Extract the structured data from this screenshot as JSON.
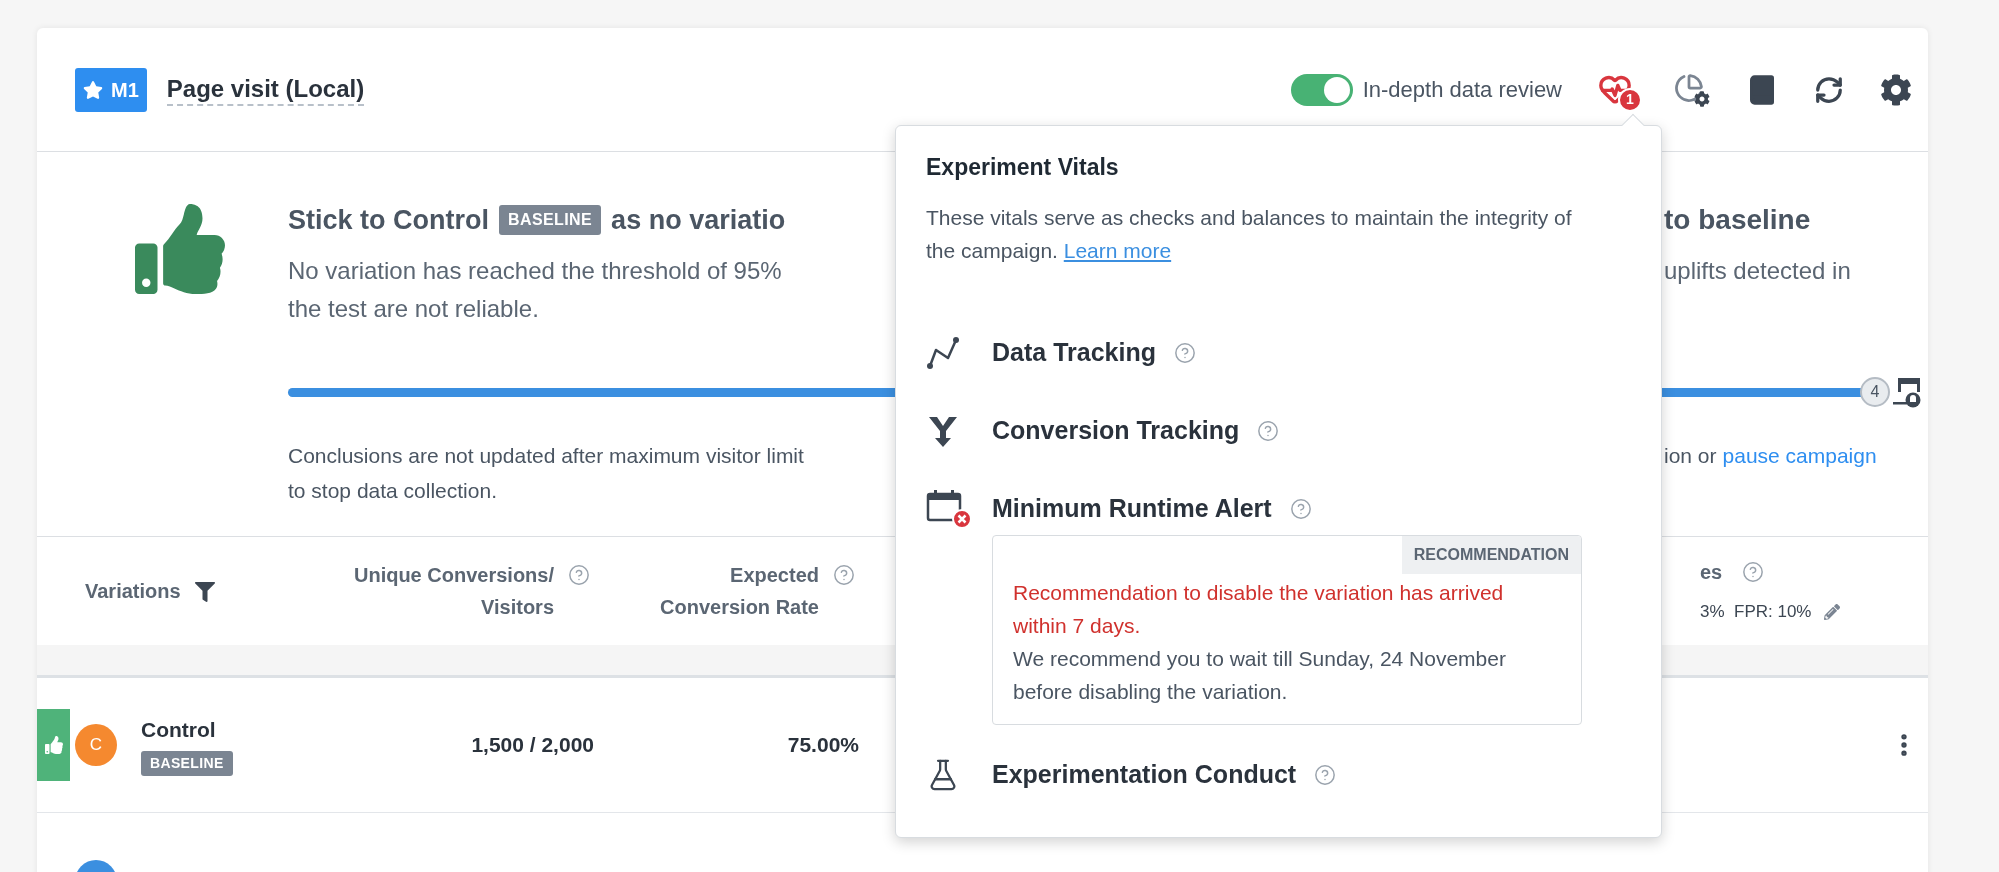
{
  "header": {
    "badge": "M1",
    "title": "Page visit (Local)",
    "toggle": {
      "label": "In-depth data review",
      "on": true
    },
    "vitals_badge": "1"
  },
  "summary": {
    "heading_start": "Stick to Control",
    "heading_badge": "BASELINE",
    "heading_middle": "as no variatio",
    "heading_end": "to baseline",
    "text_lines": [
      {
        "left": "No variation has reached the threshold of 95%",
        "right": "uplifts detected in"
      },
      {
        "left": "the test are not reliable."
      }
    ],
    "progress": {
      "level": 1,
      "count": "4"
    },
    "note_lines": [
      {
        "left": "Conclusions are not updated after maximum visitor limit",
        "right": "ion or",
        "link": "pause campaign"
      },
      {
        "left": "to stop data collection."
      }
    ]
  },
  "table": {
    "columns": [
      {
        "kind": "filter",
        "lines": [
          "Variations"
        ]
      },
      {
        "kind": "help",
        "lines": [
          "Unique Conversions/",
          "Visitors"
        ]
      },
      {
        "kind": "help",
        "lines": [
          "Expected",
          "Conversion Rate"
        ]
      }
    ],
    "right_column": {
      "label": "es",
      "subtext": "3%  FPR: 10%"
    },
    "rows": [
      {
        "avatar": "C",
        "color": "#f5892f",
        "name": "Control",
        "badge": "BASELINE",
        "winner": true,
        "cells": [
          "1,500 / 2,000",
          "75.00%"
        ]
      },
      {
        "color": "#3b8fe0",
        "winner": false
      }
    ]
  },
  "vitals": {
    "title": "Experiment Vitals",
    "description": "These vitals serve as checks and balances to maintain the integrity of the campaign.",
    "link": "Learn more",
    "items": [
      {
        "kind": "tracking",
        "label": "Data Tracking"
      },
      {
        "kind": "funnel",
        "label": "Conversion Tracking"
      },
      {
        "kind": "calendar_alert",
        "label": "Minimum Runtime Alert",
        "recommendation": {
          "tag": "RECOMMENDATION",
          "alert": "Recommendation to disable the variation has arrived within 7 days.",
          "text": "We recommend you to wait till Sunday, 24 November before disabling the variation."
        }
      },
      {
        "kind": "flask",
        "label": "Experimentation Conduct"
      }
    ]
  }
}
